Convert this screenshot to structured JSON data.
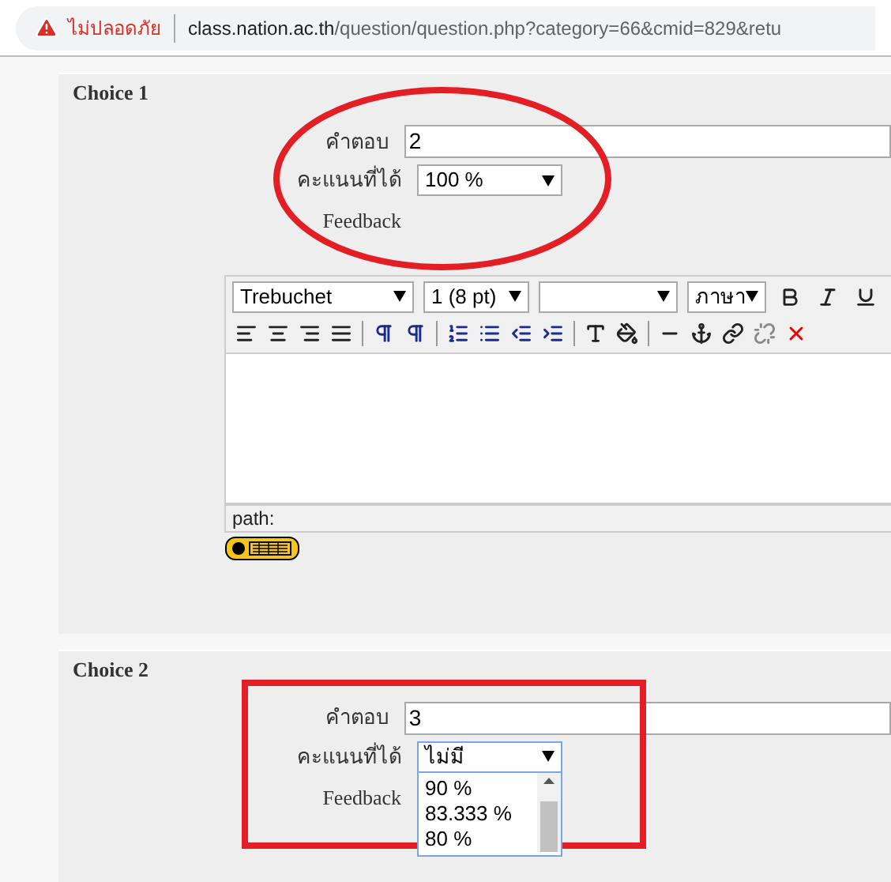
{
  "address_bar": {
    "security_warning": "ไม่ปลอดภัย",
    "host": "class.nation.ac.th",
    "path": "/question/question.php?category=66&cmid=829&retu"
  },
  "choices": [
    {
      "legend": "Choice 1",
      "answer_label": "คำตอบ",
      "answer": "2",
      "grade_label": "คะแนนที่ได้",
      "grade": "100 %",
      "grade_expanded": false,
      "feedback_label": "Feedback",
      "annotation": {
        "kind": "ellipse",
        "color": "#e31e24"
      },
      "editor": {
        "font": "Trebuchet",
        "size": "1 (8 pt)",
        "language": "ภาษา",
        "path": "path:"
      }
    },
    {
      "legend": "Choice 2",
      "answer_label": "คำตอบ",
      "answer": "3",
      "grade_label": "คะแนนที่ได้",
      "grade": "ไม่มี",
      "grade_expanded": true,
      "grade_options": [
        "90 %",
        "83.333 %",
        "80 %"
      ],
      "feedback_label": "Feedback",
      "annotation": {
        "kind": "rect",
        "color": "#e31e24"
      }
    }
  ]
}
